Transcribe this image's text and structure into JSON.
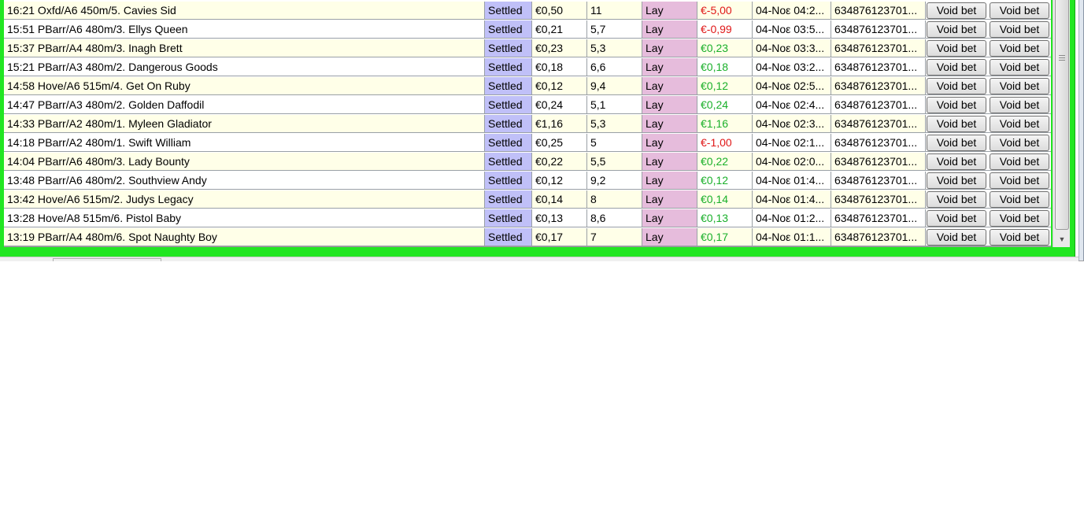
{
  "colors": {
    "frame": "#22e622",
    "status_col": "#c0c0f8",
    "side_col": "#e6bcdc",
    "positive": "#1ab02a",
    "negative": "#e01818",
    "row_odd": "#ffffe8",
    "row_even": "#ffffff"
  },
  "icons": {
    "scroll_down": "▼",
    "scroll_grip": "grip-icon"
  },
  "bets": [
    {
      "market": "16:21 Oxfd/A6 450m/5. Cavies Sid",
      "status": "Settled",
      "stake": "€0,50",
      "odds": "11",
      "side": "Lay",
      "pl": "€-5,00",
      "pl_sign": "neg",
      "date": "04-Νοε 04:2...",
      "id": "634876123701...",
      "void1": "Void bet",
      "void2": "Void bet"
    },
    {
      "market": "15:51 PBarr/A6 480m/3. Ellys Queen",
      "status": "Settled",
      "stake": "€0,21",
      "odds": "5,7",
      "side": "Lay",
      "pl": "€-0,99",
      "pl_sign": "neg",
      "date": "04-Νοε 03:5...",
      "id": "634876123701...",
      "void1": "Void bet",
      "void2": "Void bet"
    },
    {
      "market": "15:37 PBarr/A4 480m/3. Inagh Brett",
      "status": "Settled",
      "stake": "€0,23",
      "odds": "5,3",
      "side": "Lay",
      "pl": "€0,23",
      "pl_sign": "pos",
      "date": "04-Νοε 03:3...",
      "id": "634876123701...",
      "void1": "Void bet",
      "void2": "Void bet"
    },
    {
      "market": "15:21 PBarr/A3 480m/2. Dangerous Goods",
      "status": "Settled",
      "stake": "€0,18",
      "odds": "6,6",
      "side": "Lay",
      "pl": "€0,18",
      "pl_sign": "pos",
      "date": "04-Νοε 03:2...",
      "id": "634876123701...",
      "void1": "Void bet",
      "void2": "Void bet"
    },
    {
      "market": "14:58 Hove/A6 515m/4. Get On Ruby",
      "status": "Settled",
      "stake": "€0,12",
      "odds": "9,4",
      "side": "Lay",
      "pl": "€0,12",
      "pl_sign": "pos",
      "date": "04-Νοε 02:5...",
      "id": "634876123701...",
      "void1": "Void bet",
      "void2": "Void bet"
    },
    {
      "market": "14:47 PBarr/A3 480m/2. Golden Daffodil",
      "status": "Settled",
      "stake": "€0,24",
      "odds": "5,1",
      "side": "Lay",
      "pl": "€0,24",
      "pl_sign": "pos",
      "date": "04-Νοε 02:4...",
      "id": "634876123701...",
      "void1": "Void bet",
      "void2": "Void bet"
    },
    {
      "market": "14:33 PBarr/A2 480m/1. Myleen Gladiator",
      "status": "Settled",
      "stake": "€1,16",
      "odds": "5,3",
      "side": "Lay",
      "pl": "€1,16",
      "pl_sign": "pos",
      "date": "04-Νοε 02:3...",
      "id": "634876123701...",
      "void1": "Void bet",
      "void2": "Void bet"
    },
    {
      "market": "14:18 PBarr/A2 480m/1. Swift William",
      "status": "Settled",
      "stake": "€0,25",
      "odds": "5",
      "side": "Lay",
      "pl": "€-1,00",
      "pl_sign": "neg",
      "date": "04-Νοε 02:1...",
      "id": "634876123701...",
      "void1": "Void bet",
      "void2": "Void bet"
    },
    {
      "market": "14:04 PBarr/A6 480m/3. Lady Bounty",
      "status": "Settled",
      "stake": "€0,22",
      "odds": "5,5",
      "side": "Lay",
      "pl": "€0,22",
      "pl_sign": "pos",
      "date": "04-Νοε 02:0...",
      "id": "634876123701...",
      "void1": "Void bet",
      "void2": "Void bet"
    },
    {
      "market": "13:48 PBarr/A6 480m/2. Southview Andy",
      "status": "Settled",
      "stake": "€0,12",
      "odds": "9,2",
      "side": "Lay",
      "pl": "€0,12",
      "pl_sign": "pos",
      "date": "04-Νοε 01:4...",
      "id": "634876123701...",
      "void1": "Void bet",
      "void2": "Void bet"
    },
    {
      "market": "13:42 Hove/A6 515m/2. Judys Legacy",
      "status": "Settled",
      "stake": "€0,14",
      "odds": "8",
      "side": "Lay",
      "pl": "€0,14",
      "pl_sign": "pos",
      "date": "04-Νοε 01:4...",
      "id": "634876123701...",
      "void1": "Void bet",
      "void2": "Void bet"
    },
    {
      "market": "13:28 Hove/A8 515m/6. Pistol Baby",
      "status": "Settled",
      "stake": "€0,13",
      "odds": "8,6",
      "side": "Lay",
      "pl": "€0,13",
      "pl_sign": "pos",
      "date": "04-Νοε 01:2...",
      "id": "634876123701...",
      "void1": "Void bet",
      "void2": "Void bet"
    },
    {
      "market": "13:19 PBarr/A4 480m/6. Spot Naughty Boy",
      "status": "Settled",
      "stake": "€0,17",
      "odds": "7",
      "side": "Lay",
      "pl": "€0,17",
      "pl_sign": "pos",
      "date": "04-Νοε 01:1...",
      "id": "634876123701...",
      "void1": "Void bet",
      "void2": "Void bet"
    }
  ]
}
